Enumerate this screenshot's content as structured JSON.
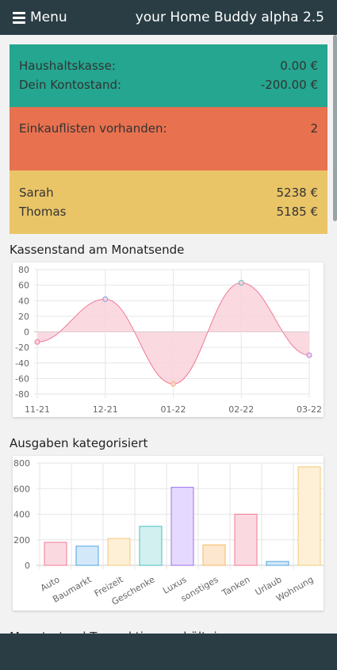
{
  "header": {
    "menu_label": "Menu",
    "app_title": "your Home Buddy alpha 2.5",
    "menu_icon": "hamburger-icon"
  },
  "summary": {
    "cash_label": "Haushaltskasse:",
    "cash_value": "0.00 €",
    "balance_label": "Dein Kontostand:",
    "balance_value": "-200.00 €",
    "lists_label": "Einkauflisten vorhanden:",
    "lists_value": "2",
    "people": [
      {
        "name": "Sarah",
        "value": "5238 €"
      },
      {
        "name": "Thomas",
        "value": "5185 €"
      }
    ],
    "colors": {
      "green": "#24a690",
      "red": "#e8714f",
      "yellow": "#eac567"
    }
  },
  "sections": {
    "line_title": "Kassenstand am Monatsende",
    "bar_title": "Ausgaben kategorisiert",
    "cut_title": "Monatsstand Transaktionsverhältnis"
  },
  "chart_data": [
    {
      "type": "line",
      "title": "Kassenstand am Monatsende",
      "categories": [
        "11-21",
        "12-21",
        "01-22",
        "02-22",
        "03-22"
      ],
      "values": [
        -13,
        42,
        -67,
        63,
        -30
      ],
      "ylim": [
        -80,
        80
      ],
      "yticks": [
        80,
        60,
        40,
        20,
        0,
        -20,
        -40,
        -60,
        -80
      ],
      "grid": true,
      "fill": "to-zero",
      "colors": {
        "line": "#f07a96",
        "fill": "#f9d2dc"
      },
      "point_colors": [
        "#f07a96",
        "#7d9df0",
        "#f5b860",
        "#5fb8b0",
        "#b17df0"
      ]
    },
    {
      "type": "bar",
      "title": "Ausgaben kategorisiert",
      "categories": [
        "Auto",
        "Baumarkt",
        "Freizeit",
        "Geschenke",
        "Luxus",
        "sonstiges",
        "Tanken",
        "Urlaub",
        "Wohnung"
      ],
      "values": [
        180,
        150,
        210,
        305,
        610,
        160,
        400,
        30,
        770
      ],
      "ylim": [
        0,
        800
      ],
      "yticks": [
        800,
        600,
        400,
        200,
        0
      ],
      "grid": true,
      "fills": [
        "#fbd9e1",
        "#d3e9f9",
        "#fdf0d6",
        "#d3f0f0",
        "#e6d9ff",
        "#fde8cf",
        "#fbd9e1",
        "#d3e9f9",
        "#fdf0d6"
      ],
      "strokes": [
        "#f07a96",
        "#4fa3e0",
        "#f5c97a",
        "#4bbfbf",
        "#9b6ff0",
        "#f5b860",
        "#f07a96",
        "#4fa3e0",
        "#f5c97a"
      ]
    }
  ]
}
